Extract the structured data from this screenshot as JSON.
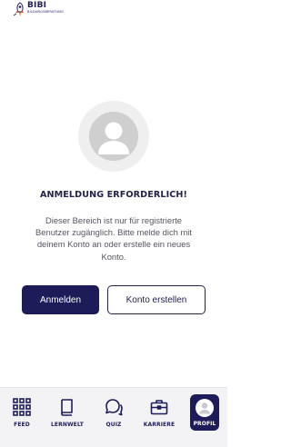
{
  "colors": {
    "primary": "#1e1c58",
    "text_dark": "#23224a",
    "text_muted": "#555561",
    "nav_background": "#f3f3f6"
  },
  "header": {
    "logo_text": "BIBI",
    "logo_subtext": "BILDUNGSBERATUNG"
  },
  "main": {
    "avatar_icon": "user-avatar-icon",
    "title": "ANMELDUNG ERFORDERLICH!",
    "message": "Dieser Bereich ist nur für registrierte Benutzer zugänglich. Bitte melde dich mit deinem Konto an oder erstelle ein neues Konto.",
    "login_button": "Anmelden",
    "register_button": "Konto erstellen"
  },
  "nav": {
    "items": [
      {
        "label": "FEED",
        "icon": "grid-icon"
      },
      {
        "label": "LERNWELT",
        "icon": "book-icon"
      },
      {
        "label": "QUIZ",
        "icon": "chat-icon"
      },
      {
        "label": "KARRIERE",
        "icon": "briefcase-icon"
      },
      {
        "label": "PROFIL",
        "icon": "profile-icon",
        "active": true
      }
    ]
  }
}
